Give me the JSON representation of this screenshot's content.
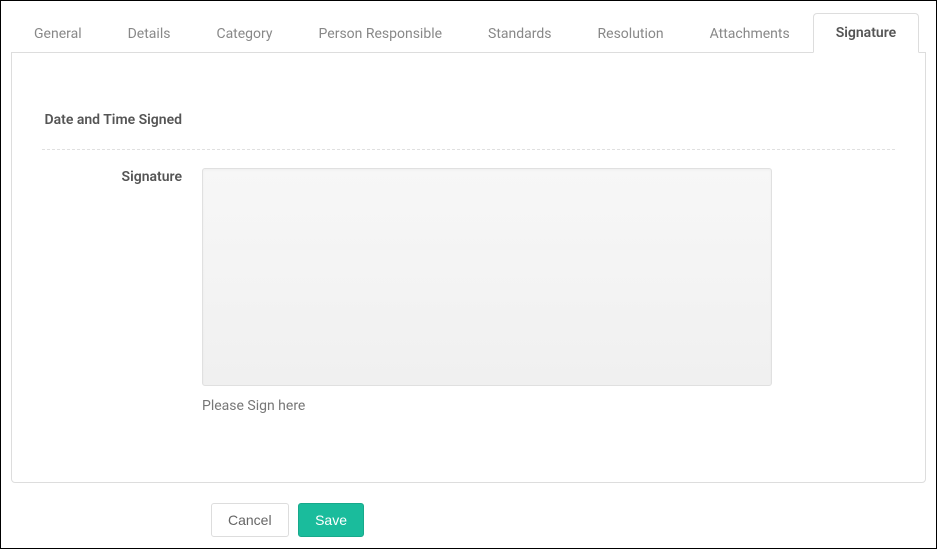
{
  "tabs": [
    {
      "label": "General"
    },
    {
      "label": "Details"
    },
    {
      "label": "Category"
    },
    {
      "label": "Person Responsible"
    },
    {
      "label": "Standards"
    },
    {
      "label": "Resolution"
    },
    {
      "label": "Attachments"
    },
    {
      "label": "Signature"
    }
  ],
  "activeTab": 7,
  "form": {
    "dateTimeLabel": "Date and Time Signed",
    "dateTimeValue": "",
    "signatureLabel": "Signature",
    "signatureHint": "Please Sign here"
  },
  "buttons": {
    "cancel": "Cancel",
    "save": "Save"
  }
}
